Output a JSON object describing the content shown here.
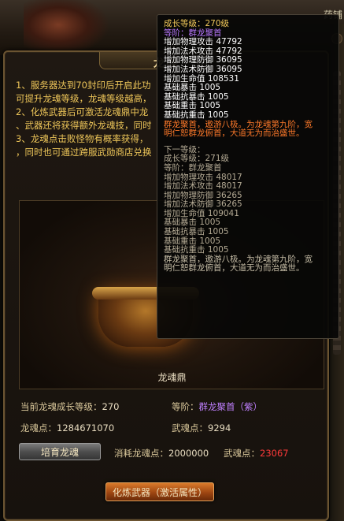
{
  "background": {
    "top_right_label": "药铺"
  },
  "dialog": {
    "title": "龙魂",
    "info_lines": [
      "1、服务器达到70封印后开启此功",
      "可提升龙魂等级，龙魂等级越高，",
      "2、化炼武器后可激活龙魂鼎中龙",
      "、武器还将获得额外龙魂技，同时",
      "3、龙魂点击败怪物有概率获得，",
      "，同时也可通过跨服武勋商店兑换"
    ],
    "cauldron_label": "龙魂鼎",
    "growth_level_label": "当前龙魂成长等级：",
    "growth_level_value": "270",
    "rank_label": "等阶：",
    "rank_value": "群龙聚首（紫）",
    "dragon_soul_points_label": "龙魂点：",
    "dragon_soul_points_value": "1284671070",
    "weapon_soul_label": "武魂点：",
    "weapon_soul_value": "9294",
    "cultivate_button": "培育龙魂",
    "cost_dragon_label": "消耗龙魂点：",
    "cost_dragon_value": "2000000",
    "cost_weapon_label": "武魂点：",
    "cost_weapon_value": "23067",
    "refine_button": "化炼武器（激活属性）"
  },
  "tooltip": {
    "current": {
      "level": "成长等级：270级",
      "rank": "等阶：群龙聚首",
      "stats": [
        "增加物理攻击 47792",
        "增加法术攻击 47792",
        "增加物理防御 36095",
        "增加法术防御 36095",
        "增加生命值 108531",
        "基础暴击 1005",
        "基础抗暴击 1005",
        "基础重击 1005",
        "基础抗重击 1005"
      ],
      "desc_1": "群龙聚首，遨游八极。为龙魂第九阶，宽",
      "desc_2": "明仁恕群龙俯首，大道无为而治盛世。"
    },
    "next_title": "下一等级：",
    "next": {
      "level": "成长等级：271级",
      "rank": "等阶：群龙聚首",
      "stats": [
        "增加物理攻击 48017",
        "增加法术攻击 48017",
        "增加物理防御 36265",
        "增加法术防御 36265",
        "增加生命值 109041",
        "基础暴击 1005",
        "基础抗暴击 1005",
        "基础重击 1005",
        "基础抗重击 1005"
      ],
      "desc_1": "群龙聚首，遨游八极。为龙魂第九阶，宽",
      "desc_2": "明仁恕群龙俯首，大道无为而治盛世。"
    }
  },
  "colors": {
    "gold_text": "#f0c85a",
    "purple_rank": "#c080ff",
    "red_value": "#ff3a3a",
    "orange_desc": "#ff7a2a"
  }
}
